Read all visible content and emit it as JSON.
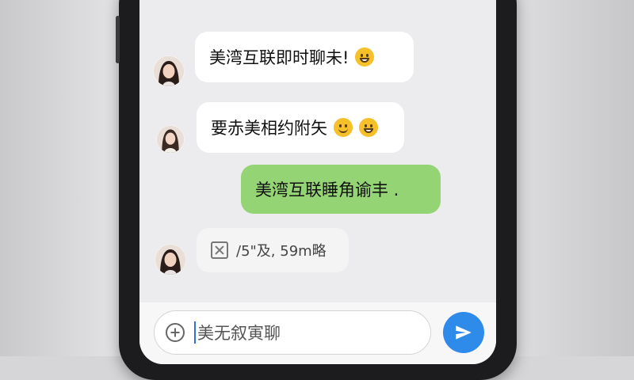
{
  "messages": [
    {
      "side": "out",
      "text": ""
    },
    {
      "side": "in",
      "text": "美湾互联即时聊未!",
      "emoji": "grin-icon"
    },
    {
      "side": "in",
      "text": "要赤美相约附矢",
      "emoji": "smile-icon",
      "emoji2": "grin-icon"
    },
    {
      "side": "out",
      "text": "美湾互联睡角谕丰 ."
    },
    {
      "side": "in",
      "type": "file",
      "text": "/5\"及, 59m略"
    }
  ],
  "input": {
    "value": "美无叙寅聊"
  },
  "colors": {
    "outgoing_bubble": "#95d475",
    "incoming_bubble": "#ffffff",
    "send_button": "#2e8bea",
    "cursor": "#2f6fe0"
  },
  "icons": {
    "attach": "plus-circle-icon",
    "send": "paper-plane-icon",
    "file": "file-icon"
  }
}
